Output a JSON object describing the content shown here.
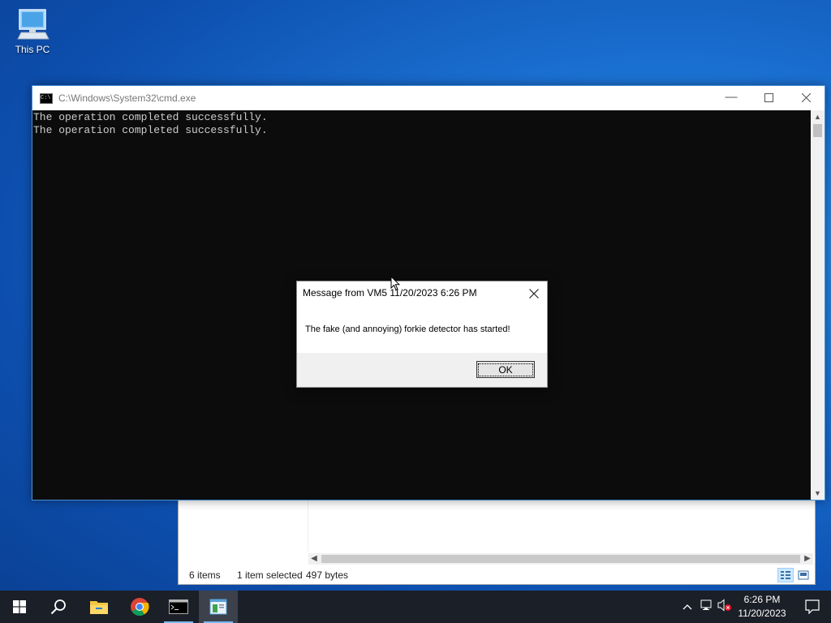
{
  "desktop": {
    "icon_label": "This PC"
  },
  "cmd": {
    "title": "C:\\Windows\\System32\\cmd.exe",
    "output_lines": [
      "The operation completed successfully.",
      "The operation completed successfully."
    ]
  },
  "explorer": {
    "items_count": "6 items",
    "selection": "1 item selected",
    "size": "497 bytes"
  },
  "msgbox": {
    "title": "Message from VM5 11/20/2023 6:26 PM",
    "message": "The fake (and annoying) forkie detector has started!",
    "ok_label": "OK"
  },
  "taskbar": {
    "time": "6:26 PM",
    "date": "11/20/2023",
    "icons": [
      "start-icon",
      "search-icon",
      "file-explorer-icon",
      "chrome-icon",
      "cmd-icon",
      "notepad-icon"
    ]
  }
}
